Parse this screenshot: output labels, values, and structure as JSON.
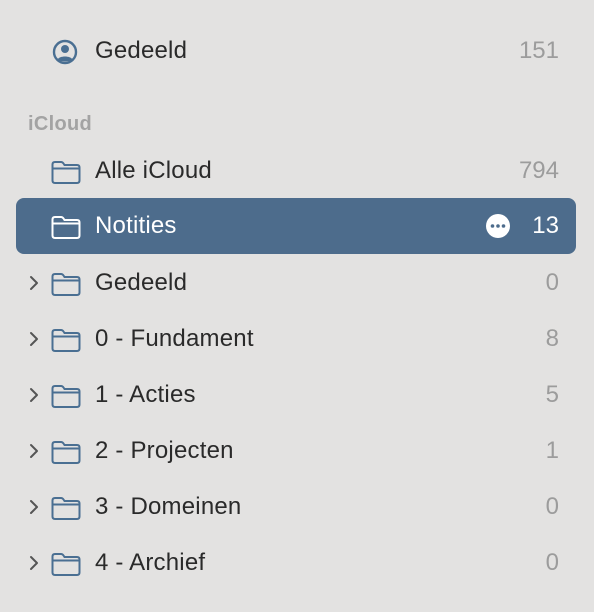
{
  "top": {
    "shared": {
      "label": "Gedeeld",
      "count": "151",
      "icon": "person-circle-icon"
    }
  },
  "section": {
    "title": "iCloud",
    "items": [
      {
        "label": "Alle iCloud",
        "count": "794",
        "icon": "folder-icon",
        "expandable": false,
        "selected": false
      },
      {
        "label": "Notities",
        "count": "13",
        "icon": "folder-icon",
        "expandable": false,
        "selected": true
      },
      {
        "label": "Gedeeld",
        "count": "0",
        "icon": "folder-icon",
        "expandable": true,
        "selected": false
      },
      {
        "label": "0 - Fundament",
        "count": "8",
        "icon": "folder-icon",
        "expandable": true,
        "selected": false
      },
      {
        "label": "1 - Acties",
        "count": "5",
        "icon": "folder-icon",
        "expandable": true,
        "selected": false
      },
      {
        "label": "2 - Projecten",
        "count": "1",
        "icon": "folder-icon",
        "expandable": true,
        "selected": false
      },
      {
        "label": "3 - Domeinen",
        "count": "0",
        "icon": "folder-icon",
        "expandable": true,
        "selected": false
      },
      {
        "label": "4 - Archief",
        "count": "0",
        "icon": "folder-icon",
        "expandable": true,
        "selected": false
      }
    ]
  },
  "colors": {
    "background": "#e3e2e1",
    "selection": "#4d6c8c",
    "folder_icon": "#4a6f92",
    "count_text": "#9c9c9c"
  }
}
